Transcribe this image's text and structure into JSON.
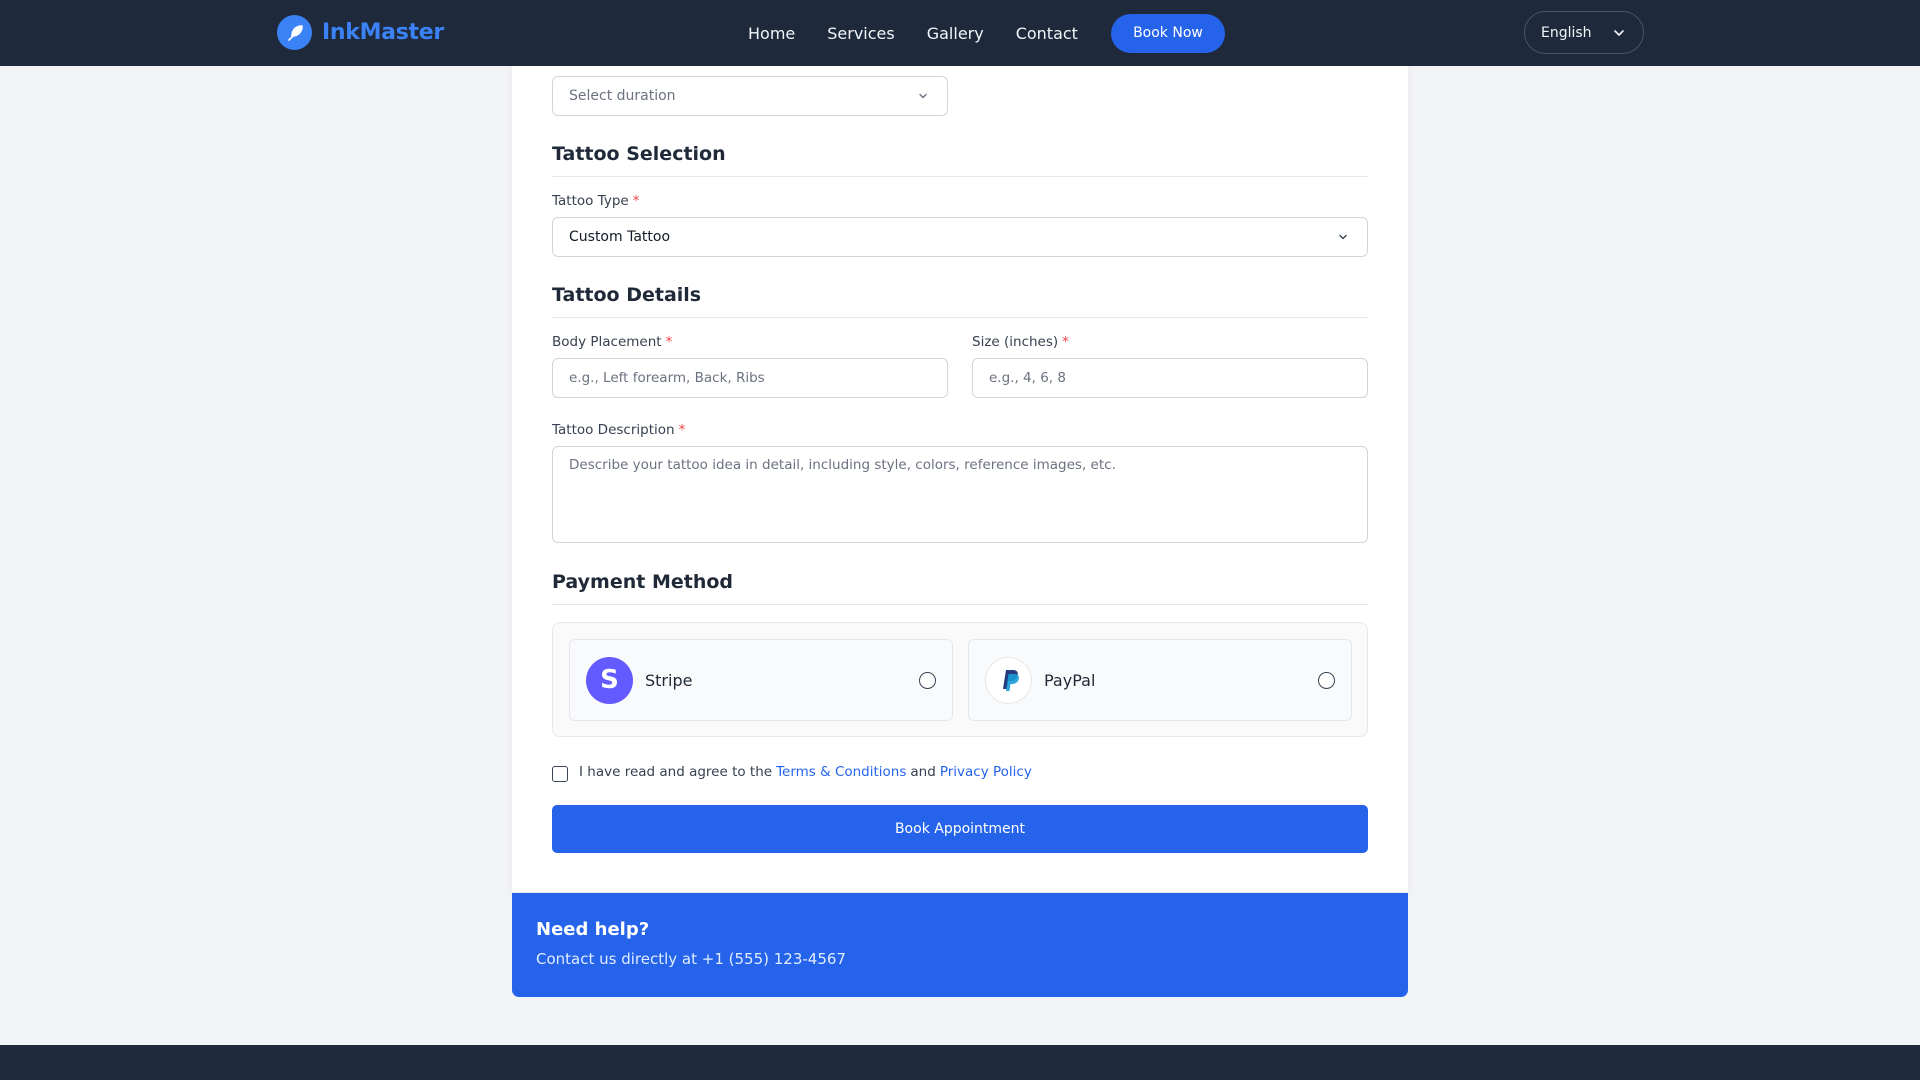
{
  "header": {
    "brand": "InkMaster",
    "nav": [
      "Home",
      "Services",
      "Gallery",
      "Contact"
    ],
    "book_now": "Book Now",
    "language": "English",
    "accent": "#3b82f6"
  },
  "form": {
    "duration_select": {
      "placeholder": "Select duration"
    },
    "tattoo_selection": {
      "title": "Tattoo Selection",
      "type_label": "Tattoo Type",
      "type_value": "Custom Tattoo"
    },
    "tattoo_details": {
      "title": "Tattoo Details",
      "placement_label": "Body Placement",
      "placement_placeholder": "e.g., Left forearm, Back, Ribs",
      "size_label": "Size (inches)",
      "size_placeholder": "e.g., 4, 6, 8",
      "description_label": "Tattoo Description",
      "description_placeholder": "Describe your tattoo idea in detail, including style, colors, reference images, etc."
    },
    "required_mark": "*",
    "payment": {
      "title": "Payment Method",
      "options": [
        {
          "name": "Stripe",
          "icon": "stripe-logo-icon",
          "selected": false
        },
        {
          "name": "PayPal",
          "icon": "paypal-logo-icon",
          "selected": false
        }
      ]
    },
    "agreement": {
      "prefix": "I have read and agree to the",
      "terms": "Terms & Conditions",
      "and": "and",
      "privacy": "Privacy Policy",
      "checked": false
    },
    "submit": "Book Appointment"
  },
  "help": {
    "title": "Need help?",
    "text": "Contact us directly at +1 (555) 123-4567"
  },
  "colors": {
    "primary": "#2563eb",
    "header_bg": "#1e293b",
    "required": "#ef4444",
    "stripe": "#635bff"
  }
}
